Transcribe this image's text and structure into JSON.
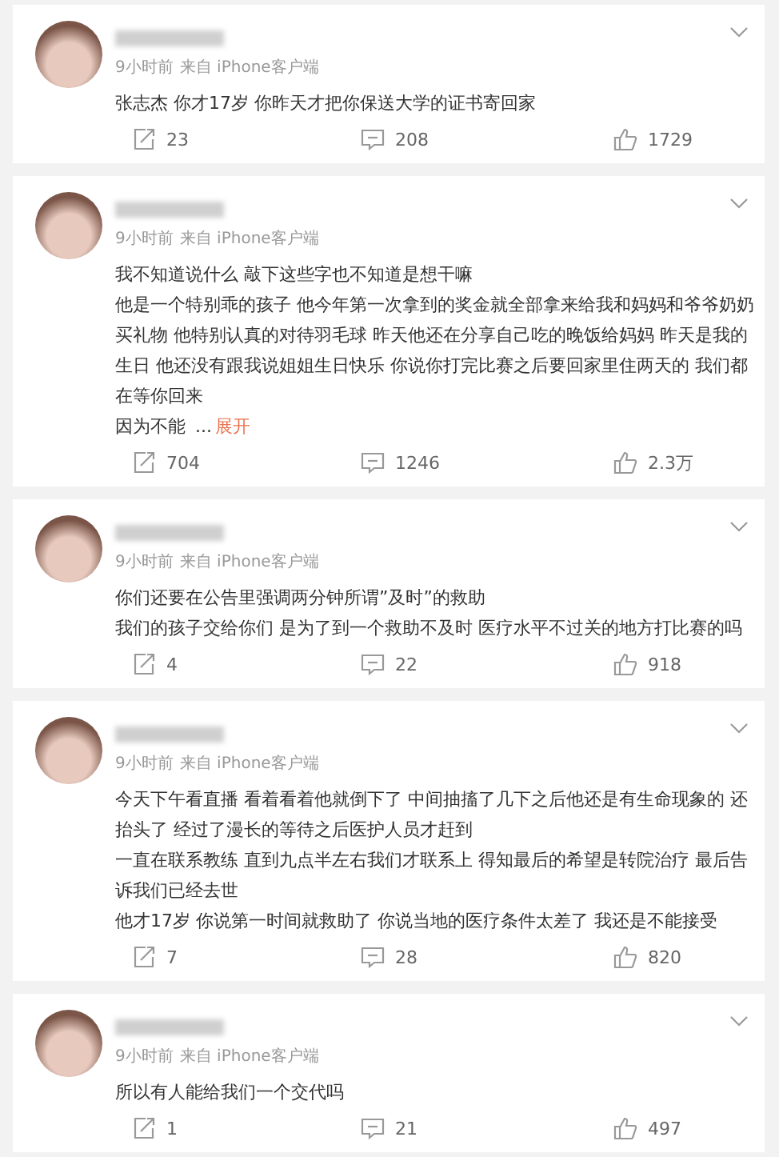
{
  "comments": [
    {
      "time": "9小时前",
      "source": "来自 iPhone客户端",
      "paragraphs": [
        "张志杰 你才17岁 你昨天才把你保送大学的证书寄回家"
      ],
      "reposts": "23",
      "replies": "208",
      "likes": "1729"
    },
    {
      "time": "9小时前",
      "source": "来自 iPhone客户端",
      "paragraphs": [
        "我不知道说什么 敲下这些字也不知道是想干嘛",
        "他是一个特别乖的孩子 他今年第一次拿到的奖金就全部拿来给我和妈妈和爷爷奶奶买礼物 他特别认真的对待羽毛球 昨天他还在分享自己吃的晚饭给妈妈 昨天是我的生日 他还没有跟我说姐姐生日快乐 你说你打完比赛之后要回家里住两天的 我们都在等你回来",
        "因为不能"
      ],
      "ellipsis": "...",
      "expand": "展开",
      "reposts": "704",
      "replies": "1246",
      "likes": "2.3万"
    },
    {
      "time": "9小时前",
      "source": "来自 iPhone客户端",
      "paragraphs": [
        "你们还要在公告里强调两分钟所谓”及时”的救助",
        "我们的孩子交给你们 是为了到一个救助不及时 医疗水平不过关的地方打比赛的吗"
      ],
      "reposts": "4",
      "replies": "22",
      "likes": "918"
    },
    {
      "time": "9小时前",
      "source": "来自 iPhone客户端",
      "paragraphs": [
        "今天下午看直播 看着看着他就倒下了 中间抽搐了几下之后他还是有生命现象的 还抬头了 经过了漫长的等待之后医护人员才赶到",
        "一直在联系教练 直到九点半左右我们才联系上 得知最后的希望是转院治疗  最后告诉我们已经去世",
        "他才17岁 你说第一时间就救助了 你说当地的医疗条件太差了 我还是不能接受"
      ],
      "reposts": "7",
      "replies": "28",
      "likes": "820"
    },
    {
      "time": "9小时前",
      "source": "来自 iPhone客户端",
      "paragraphs": [
        "所以有人能给我们一个交代吗"
      ],
      "reposts": "1",
      "replies": "21",
      "likes": "497"
    }
  ]
}
